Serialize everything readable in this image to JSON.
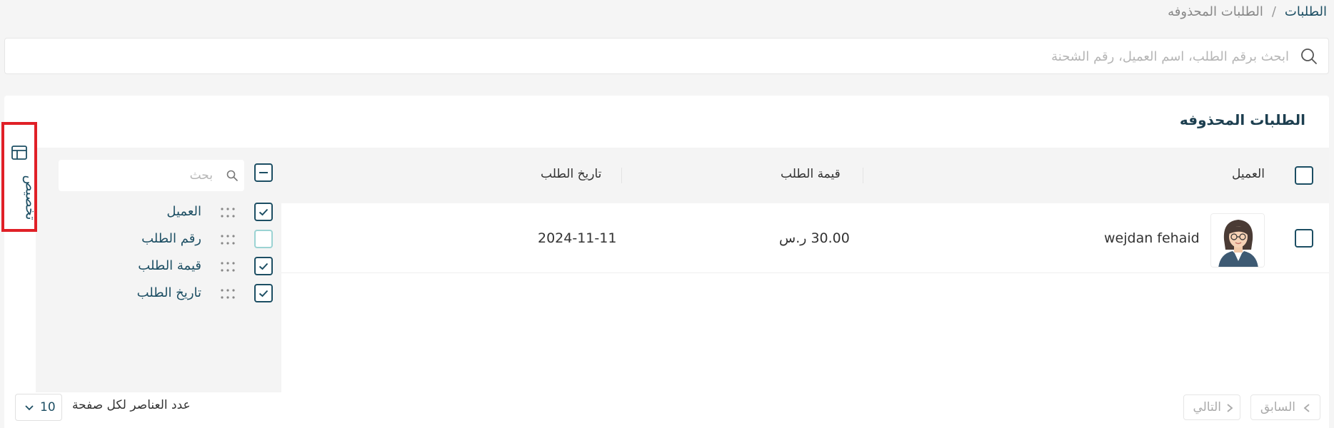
{
  "breadcrumb": {
    "parent": "الطلبات",
    "separator": "/",
    "current": "الطلبات المحذوفه"
  },
  "search": {
    "placeholder": "ابحث برقم الطلب، اسم العميل، رقم الشحنة",
    "value": ""
  },
  "card": {
    "title": "الطلبات المحذوفه"
  },
  "table": {
    "columns": [
      "العميل",
      "قيمة الطلب",
      "تاريخ الطلب"
    ],
    "rows": [
      {
        "customer": "wejdan fehaid",
        "value": "30.00 ر.س",
        "date": "2024-11-11",
        "selected": false
      }
    ]
  },
  "customize_panel": {
    "search_placeholder": "بحث",
    "items": [
      {
        "label": "العميل",
        "checked": true
      },
      {
        "label": "رقم الطلب",
        "checked": false
      },
      {
        "label": "قيمة الطلب",
        "checked": true
      },
      {
        "label": "تاريخ الطلب",
        "checked": true
      }
    ],
    "tab_label": "تخصيص"
  },
  "footer": {
    "page_size": "10",
    "per_page_label": "عدد العناصر لكل صفحة",
    "prev_label": "السابق",
    "next_label": "التالي"
  },
  "colors": {
    "primary": "#1c4e63",
    "highlight_border": "#e02027",
    "background": "#f5f5f5"
  }
}
